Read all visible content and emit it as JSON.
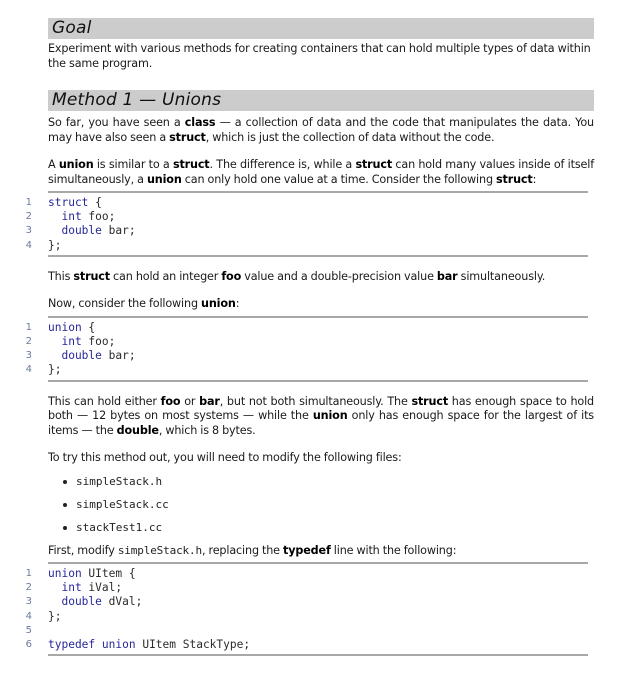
{
  "goal": {
    "heading": "Goal",
    "text": "Experiment with various methods for creating containers that can hold multiple types of data within the same program."
  },
  "method1": {
    "heading": "Method 1 — Unions",
    "para1": {
      "t1": "So far, you have seen a ",
      "b1": "class",
      "t2": " — a collection of data and the code that manipulates the data.  You may have also seen a ",
      "b2": "struct",
      "t3": ", which is just the collection of data without the code."
    },
    "para2": {
      "t1": "A ",
      "b1": "union",
      "t2": " is similar to a ",
      "b2": "struct",
      "t3": ".  The difference is, while a ",
      "b3": "struct",
      "t4": " can hold many values inside of itself simultaneously, a ",
      "b4": "union",
      "t5": " can only hold one value at a time.  Consider the following ",
      "b5": "struct",
      "t6": ":"
    },
    "code_struct": [
      {
        "n": "1",
        "kw1": "struct",
        "rest1": " {",
        "kw2": "",
        "rest2": ""
      },
      {
        "n": "2",
        "kw1": "  int",
        "rest1": " foo;",
        "kw2": "",
        "rest2": ""
      },
      {
        "n": "3",
        "kw1": "  double",
        "rest1": " bar;",
        "kw2": "",
        "rest2": ""
      },
      {
        "n": "4",
        "kw1": "",
        "rest1": "};",
        "kw2": "",
        "rest2": ""
      }
    ],
    "para3": {
      "t1": "This ",
      "b1": "struct",
      "t2": " can hold an integer ",
      "b2": "foo",
      "t3": " value and a double-precision value ",
      "b3": "bar",
      "t4": " simultaneously."
    },
    "para4": {
      "t1": "Now, consider the following ",
      "b1": "union",
      "t2": ":"
    },
    "code_union": [
      {
        "n": "1",
        "kw1": "union",
        "rest1": " {"
      },
      {
        "n": "2",
        "kw1": "  int",
        "rest1": " foo;"
      },
      {
        "n": "3",
        "kw1": "  double",
        "rest1": " bar;"
      },
      {
        "n": "4",
        "kw1": "",
        "rest1": "};"
      }
    ],
    "para5": {
      "t1": "This can hold either ",
      "b1": "foo",
      "t2": " or ",
      "b2": "bar",
      "t3": ", but not both simultaneously.  The ",
      "b3": "struct",
      "t4": " has enough space to hold both — 12 bytes on most systems — while the ",
      "b4": "union",
      "t5": " only has enough space for the largest of its items — the ",
      "b5": "double",
      "t6": ", which is 8 bytes."
    },
    "para6": "To try this method out, you will need to modify the following files:",
    "files": [
      "simpleStack.h",
      "simpleStack.cc",
      "stackTest1.cc"
    ],
    "para7": {
      "t1": "First, modify ",
      "code1": "simpleStack.h",
      "t2": ", replacing the ",
      "b1": "typedef",
      "t3": " line with the following:"
    },
    "code_uitem": [
      {
        "n": "1",
        "kw1": "union",
        "rest1": " UItem {",
        "kw2": "",
        "rest2": ""
      },
      {
        "n": "2",
        "kw1": "  int",
        "rest1": " iVal;",
        "kw2": "",
        "rest2": ""
      },
      {
        "n": "3",
        "kw1": "  double",
        "rest1": " dVal;",
        "kw2": "",
        "rest2": ""
      },
      {
        "n": "4",
        "kw1": "",
        "rest1": "};",
        "kw2": "",
        "rest2": ""
      },
      {
        "n": "5",
        "kw1": "",
        "rest1": "",
        "kw2": "",
        "rest2": ""
      },
      {
        "n": "6",
        "kw1": "typedef",
        "rest1": " ",
        "kw2": "union",
        "rest2": " UItem StackType;"
      }
    ]
  },
  "colors": {
    "heading_bar": "#cccccc",
    "keyword": "#27279a",
    "rule": "#a8a8a8",
    "line_number": "#6b7aa0"
  }
}
